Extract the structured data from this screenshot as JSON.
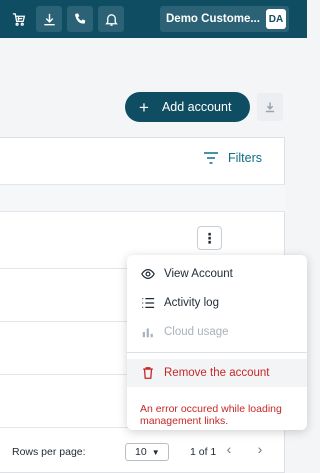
{
  "topbar": {
    "account_name": "Demo Custome...",
    "avatar_initials": "DA",
    "bg_color": "#0f4d63"
  },
  "toolbar": {
    "add_account_label": "Add account",
    "add_account_icon": "plus-icon",
    "download_icon": "download-icon"
  },
  "table": {
    "filters_label": "Filters"
  },
  "row_menu": {
    "items": [
      {
        "label": "View Account",
        "icon": "eye-icon",
        "enabled": true
      },
      {
        "label": "Activity log",
        "icon": "list-icon",
        "enabled": true
      },
      {
        "label": "Cloud usage",
        "icon": "bar-chart-icon",
        "enabled": false
      },
      {
        "label": "Remove the account",
        "icon": "trash-icon",
        "enabled": true
      }
    ],
    "error_message": "An error occured while loading management links."
  },
  "pagination": {
    "rows_per_page_label": "Rows per page:",
    "rows_per_page_value": "10",
    "page_info": "1 of 1",
    "prev": "‹",
    "next": "›"
  },
  "colors": {
    "primary": "#0f4d63",
    "link": "#0f6f86",
    "danger": "#c62828"
  }
}
